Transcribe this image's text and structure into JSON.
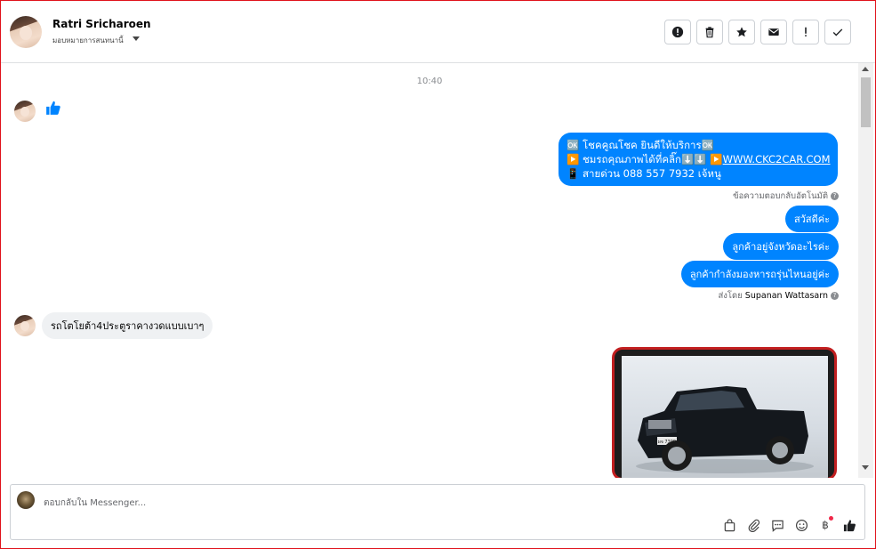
{
  "header": {
    "name": "Ratri Sricharoen",
    "subtitle": "มอบหมายการสนทนานี้",
    "actions": [
      "alert-icon",
      "trash-icon",
      "star-icon",
      "mail-icon",
      "exclamation-icon",
      "check-icon"
    ]
  },
  "thread": {
    "timestamp": "10:40",
    "auto_reply": {
      "line1": "🆗 โชคคูณโชค ยินดีให้บริการ🆗",
      "line2_prefix": "▶️ ชมรถคุณภาพได้ที่คลิ๊ก⬇️⬇️ ▶️",
      "line2_link": "WWW.CKC2CAR.COM",
      "line3": "📱 สายด่วน 088 557 7932 เจ้หนู"
    },
    "auto_reply_note": "ข้อความตอบกลับอัตโนมัติ",
    "outgoing": [
      "สวัสดีค่ะ",
      "ลูกค้าอยู่จังหวัดอะไรค่ะ",
      "ลูกค้ากำลังมองหารถรุ่นไหนอยู่ค่ะ"
    ],
    "sent_by_prefix": "ส่งโดย",
    "sent_by_name": "Supanan Wattasarn",
    "incoming_text": "รถโตโยต้า4ประตูราคางวดแบบเบาๆ",
    "car_plate": "ผจ 7399"
  },
  "composer": {
    "placeholder": "ตอบกลับใน Messenger...",
    "tools": [
      "bag-icon",
      "paperclip-icon",
      "comment-icon",
      "emoji-icon",
      "baht-icon",
      "thumbs-up-icon"
    ],
    "baht_symbol": "฿"
  },
  "colors": {
    "accent": "#0084ff",
    "border": "#e0121b",
    "photo_frame": "#c21f20"
  }
}
